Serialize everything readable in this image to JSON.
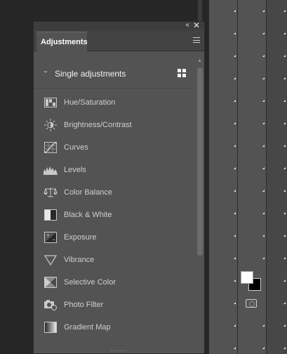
{
  "panel": {
    "tab_label": "Adjustments",
    "collapse_glyph": "‹‹",
    "close_glyph": "✕",
    "section_title": "Single adjustments",
    "items": [
      {
        "label": "Hue/Saturation",
        "icon": "hue-saturation-icon"
      },
      {
        "label": "Brightness/Contrast",
        "icon": "brightness-contrast-icon"
      },
      {
        "label": "Curves",
        "icon": "curves-icon"
      },
      {
        "label": "Levels",
        "icon": "levels-icon"
      },
      {
        "label": "Color Balance",
        "icon": "color-balance-icon"
      },
      {
        "label": "Black & White",
        "icon": "black-white-icon"
      },
      {
        "label": "Exposure",
        "icon": "exposure-icon"
      },
      {
        "label": "Vibrance",
        "icon": "vibrance-icon"
      },
      {
        "label": "Selective Color",
        "icon": "selective-color-icon"
      },
      {
        "label": "Photo Filter",
        "icon": "photo-filter-icon"
      },
      {
        "label": "Gradient Map",
        "icon": "gradient-map-icon"
      }
    ]
  },
  "colors": {
    "foreground_swatch": "#ffffff",
    "background_swatch": "#000000",
    "panel_bg": "#535353",
    "app_bg": "#262626"
  }
}
